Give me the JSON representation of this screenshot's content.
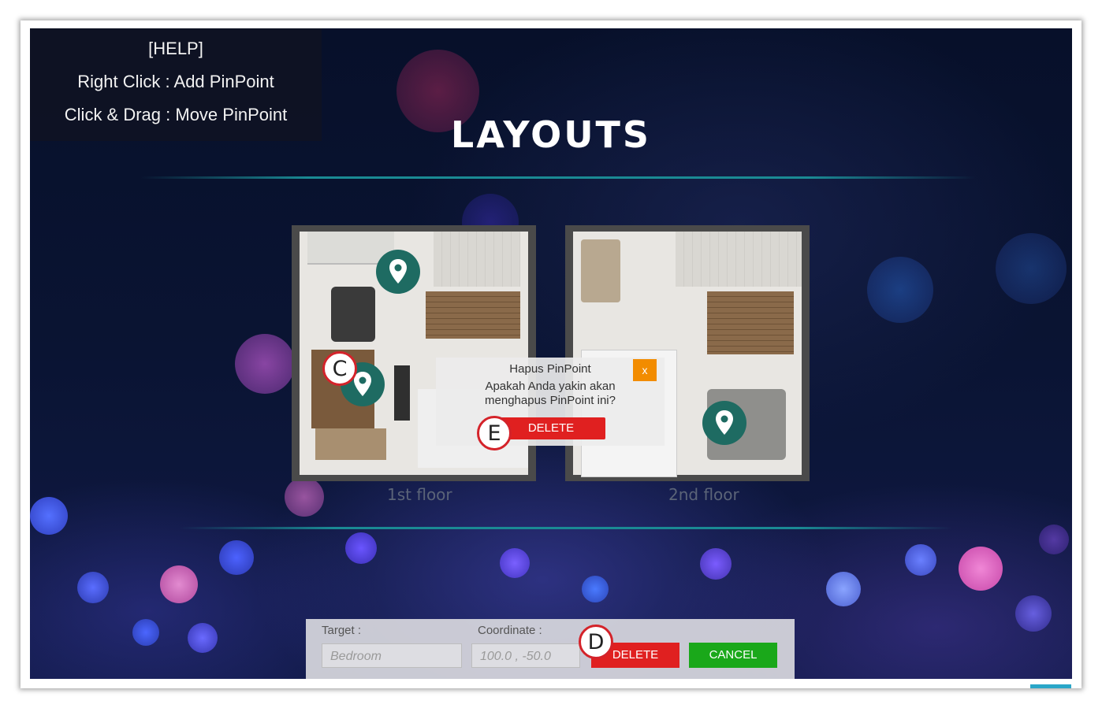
{
  "help": {
    "heading": "[HELP]",
    "line1": "Right Click : Add PinPoint",
    "line2": "Click & Drag : Move PinPoint"
  },
  "page": {
    "title": "LAYOUTS"
  },
  "floors": [
    {
      "label": "1st floor"
    },
    {
      "label": "2nd floor"
    }
  ],
  "callouts": {
    "c": "C",
    "d": "D",
    "e": "E"
  },
  "dialog": {
    "title": "Hapus PinPoint",
    "message": "Apakah Anda yakin akan menghapus PinPoint ini?",
    "close_label": "x",
    "delete_label": "DELETE"
  },
  "editor": {
    "target_label": "Target :",
    "target_placeholder": "Bedroom",
    "coordinate_label": "Coordinate :",
    "coordinate_placeholder": "100.0 , -50.0",
    "delete_label": "DELETE",
    "cancel_label": "CANCEL"
  },
  "colors": {
    "pin": "#1e6b62",
    "callout_border": "#d4232a",
    "delete": "#e02020",
    "cancel": "#1aa81a",
    "close": "#f28c00",
    "divider": "#1a8a94"
  }
}
